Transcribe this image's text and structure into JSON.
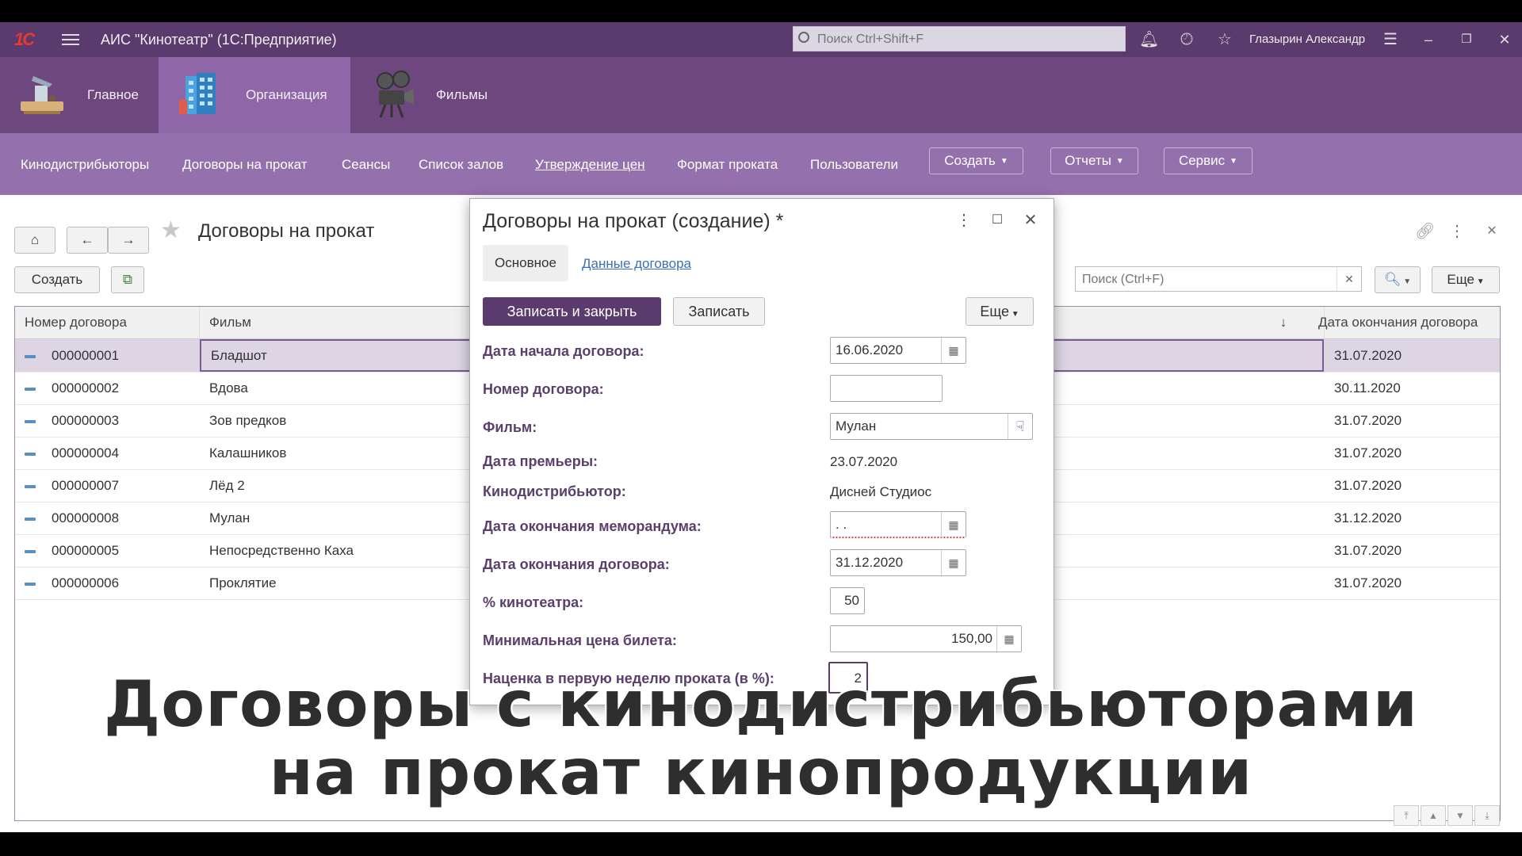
{
  "app": {
    "title": "АИС \"Кинотеатр\"  (1С:Предприятие)",
    "search_placeholder": "Поиск Ctrl+Shift+F",
    "user": "Глазырин Александр"
  },
  "sections": [
    {
      "label": "Главное",
      "icon": "desk-icon"
    },
    {
      "label": "Организация",
      "icon": "building-icon",
      "active": true
    },
    {
      "label": "Фильмы",
      "icon": "film-projector-icon"
    }
  ],
  "nav": {
    "links": [
      "Кинодистрибьюторы",
      "Договоры на прокат",
      "Сеансы",
      "Список залов",
      "Утверждение цен",
      "Формат проката",
      "Пользователи"
    ],
    "buttons": [
      "Создать",
      "Отчеты",
      "Сервис"
    ]
  },
  "list": {
    "title": "Договоры на прокат",
    "create_label": "Создать",
    "search_placeholder": "Поиск (Ctrl+F)",
    "more_label": "Еще",
    "columns": [
      "Номер договора",
      "Фильм",
      "Дата окончания договора"
    ],
    "rows": [
      {
        "num": "000000001",
        "film": "Бладшот",
        "end": "31.07.2020"
      },
      {
        "num": "000000002",
        "film": "Вдова",
        "end": "30.11.2020"
      },
      {
        "num": "000000003",
        "film": "Зов предков",
        "end": "31.07.2020"
      },
      {
        "num": "000000004",
        "film": "Калашников",
        "end": "31.07.2020"
      },
      {
        "num": "000000007",
        "film": "Лёд 2",
        "end": "31.07.2020"
      },
      {
        "num": "000000008",
        "film": "Мулан",
        "end": "31.12.2020"
      },
      {
        "num": "000000005",
        "film": "Непосредственно Каха",
        "end": "31.07.2020"
      },
      {
        "num": "000000006",
        "film": "Проклятие",
        "end": "31.07.2020"
      }
    ]
  },
  "dialog": {
    "title": "Договоры на прокат (создание) *",
    "tab_main": "Основное",
    "tab_data": "Данные договора",
    "save_close": "Записать и закрыть",
    "save": "Записать",
    "more": "Еще",
    "fields": {
      "start_date_label": "Дата начала договора:",
      "start_date": "16.06.2020",
      "number_label": "Номер договора:",
      "number": "",
      "film_label": "Фильм:",
      "film": "Мулан",
      "premiere_label": "Дата премьеры:",
      "premiere": "23.07.2020",
      "distributor_label": "Кинодистрибьютор:",
      "distributor": "Дисней Студиос",
      "memo_end_label": "Дата окончания меморандума:",
      "memo_end": " .  .",
      "contract_end_label": "Дата окончания договора:",
      "contract_end": "31.12.2020",
      "cinema_pct_label": "% кинотеатра:",
      "cinema_pct": "50",
      "min_price_label": "Минимальная цена билета:",
      "min_price": "150,00",
      "markup_label": "Наценка в первую неделю проката (в %):",
      "markup": "2"
    }
  },
  "caption": {
    "line1": "Договоры с кинодистрибьюторами",
    "line2": "на прокат кинопродукции"
  }
}
